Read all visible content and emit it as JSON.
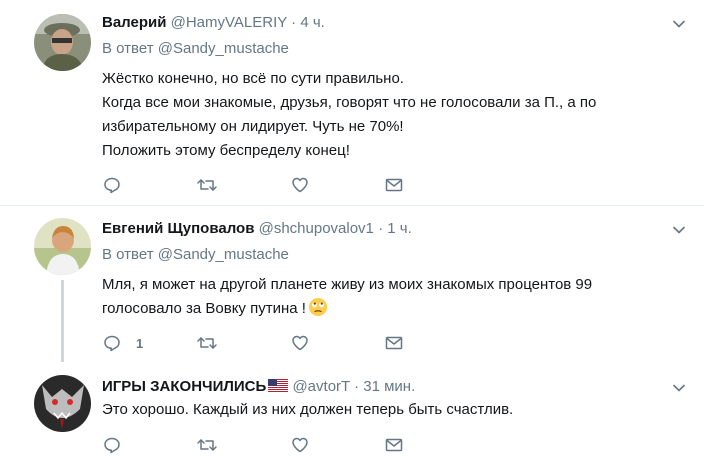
{
  "tweets": [
    {
      "name": "Валерий",
      "handle": "@HamyVALERIY",
      "separator": "·",
      "time": "4 ч.",
      "reply_prefix": "В ответ",
      "reply_mention": "@Sandy_mustache",
      "lines": [
        "Жёстко конечно, но всё по сути правильно.",
        "Когда все мои знакомые, друзья, говорят что не голосовали за П., а по",
        "избирательному он лидирует. Чуть не 70%!",
        "Положить этому беспределу конец!"
      ],
      "reply_count": ""
    },
    {
      "name": "Евгений Щуповалов",
      "handle": "@shchupovalov1",
      "separator": "·",
      "time": "1 ч.",
      "reply_prefix": "В ответ",
      "reply_mention": "@Sandy_mustache",
      "lines": [
        "Мля, я может на другой планете живу из моих знакомых процентов  99",
        "голосовало за Вовку путина !"
      ],
      "reply_count": "1"
    },
    {
      "name": "ИГРЫ ЗАКОНЧИЛИСЬ",
      "handle": "@avtorT",
      "separator": "·",
      "time": "31 мин.",
      "lines": [
        "Это хорошо. Каждый из них должен теперь быть счастлив."
      ],
      "reply_count": ""
    }
  ],
  "icons": {
    "reply": "reply-icon",
    "retweet": "retweet-icon",
    "like": "heart-icon",
    "dm": "envelope-icon",
    "caret": "chevron-down-icon"
  },
  "colors": {
    "text": "#14171a",
    "secondary": "#657786",
    "separator": "#e6ecf0",
    "thread_line": "#ccd6dd"
  }
}
